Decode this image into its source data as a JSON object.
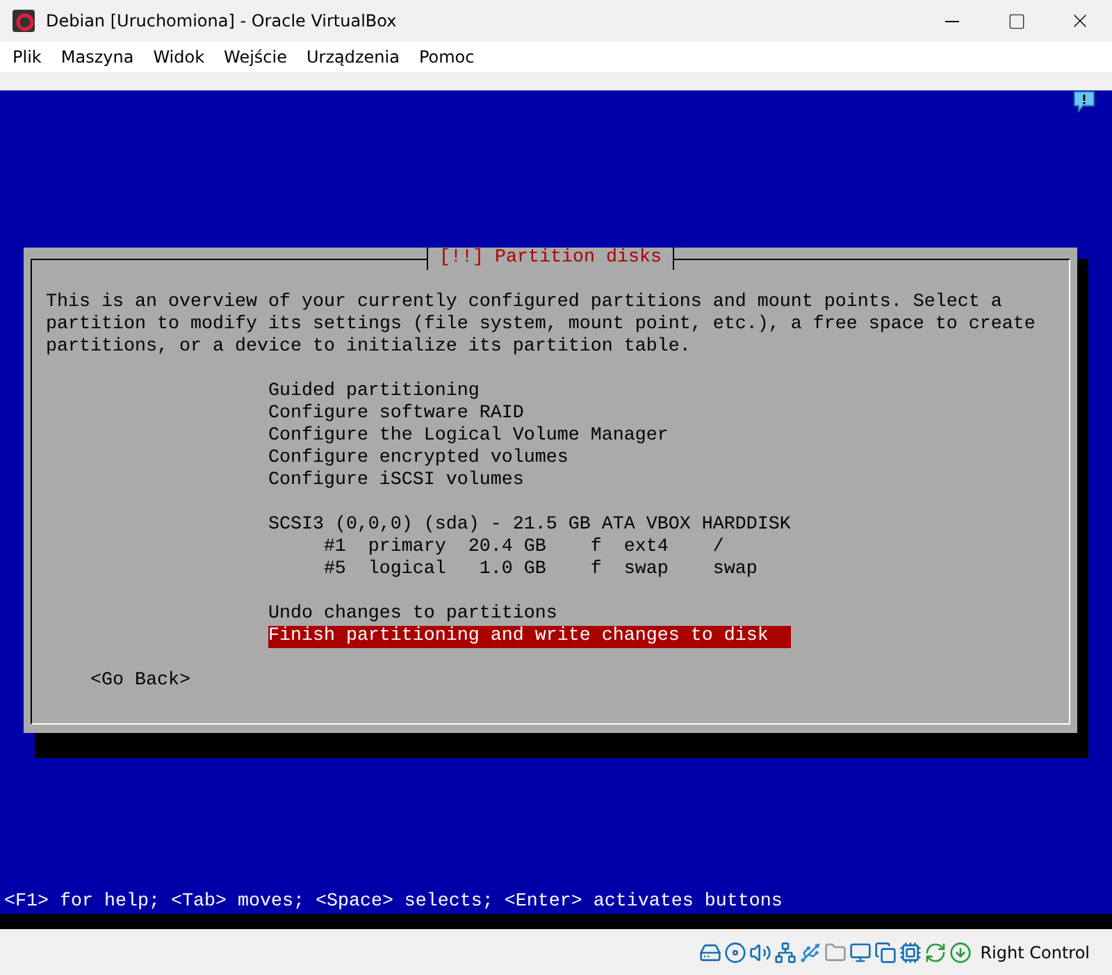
{
  "window": {
    "title": "Debian [Uruchomiona] - Oracle VirtualBox"
  },
  "menu_bar": [
    "Plik",
    "Maszyna",
    "Widok",
    "Wejście",
    "Urządzenia",
    "Pomoc"
  ],
  "dialog": {
    "title": "[!!] Partition disks",
    "description": "This is an overview of your currently configured partitions and mount points. Select a partition to modify its settings (file system, mount point, etc.), a free space to create partitions, or a device to initialize its partition table.",
    "tools": [
      {
        "label": "Guided partitioning",
        "selected": false
      },
      {
        "label": "Configure software RAID",
        "selected": false
      },
      {
        "label": "Configure the Logical Volume Manager",
        "selected": false
      },
      {
        "label": "Configure encrypted volumes",
        "selected": false
      },
      {
        "label": "Configure iSCSI volumes",
        "selected": false
      }
    ],
    "disks": [
      {
        "label": "SCSI3 (0,0,0) (sda) - 21.5 GB ATA VBOX HARDDISK",
        "selected": false,
        "partitions": [
          {
            "label": "#1  primary  20.4 GB    f  ext4    /",
            "selected": false
          },
          {
            "label": "#5  logical   1.0 GB    f  swap    swap",
            "selected": false
          }
        ]
      }
    ],
    "actions": [
      {
        "label": "Undo changes to partitions",
        "selected": false
      },
      {
        "label": "Finish partitioning and write changes to disk",
        "selected": true
      }
    ],
    "back_button": "<Go Back>"
  },
  "help_line": "<F1> for help; <Tab> moves; <Space> selects; <Enter> activates buttons",
  "host_key": "Right Control"
}
